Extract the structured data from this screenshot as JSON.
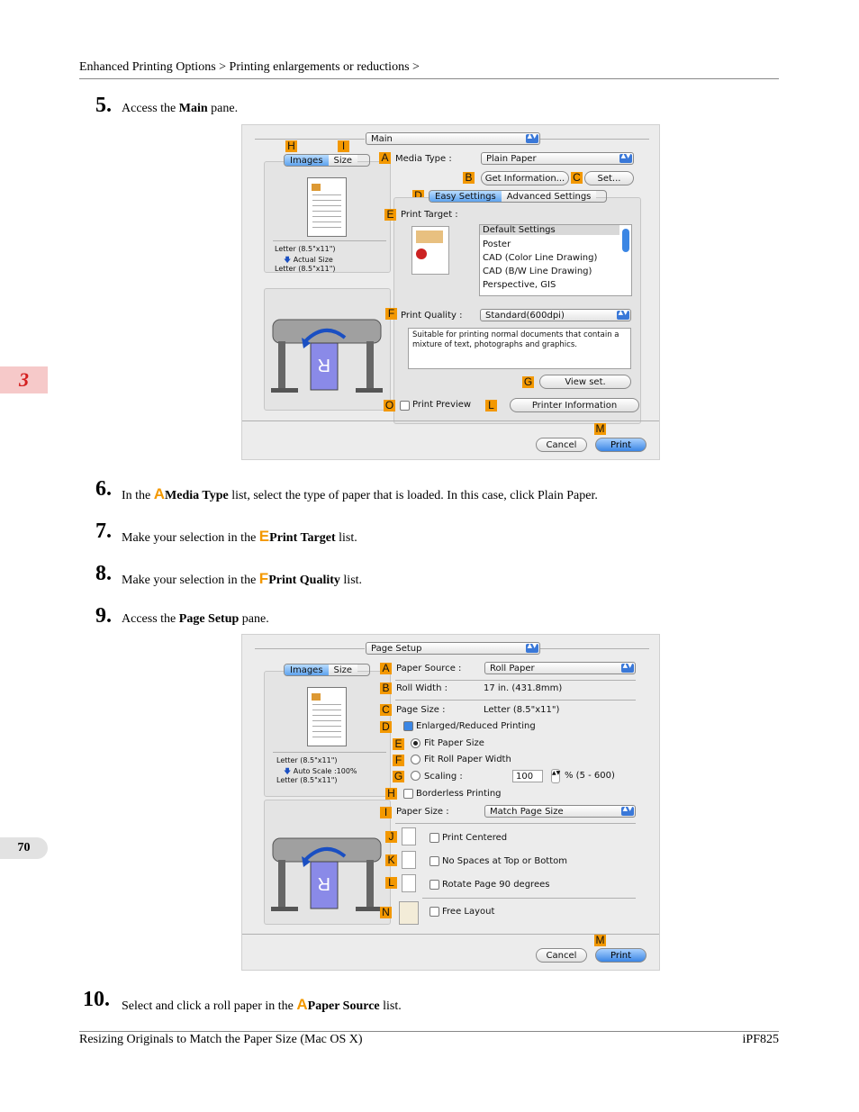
{
  "header": {
    "breadcrumb": "Enhanced Printing Options > Printing enlargements or reductions >"
  },
  "chapter": "3",
  "page_number": "70",
  "steps": [
    {
      "num": "5.",
      "pre": "Access the ",
      "bold": "Main",
      "post": " pane."
    },
    {
      "num": "6.",
      "pre": "In the ",
      "letter": "A",
      "bold": "Media Type",
      "post": " list, select the type of paper that is loaded. In this case, click Plain Paper."
    },
    {
      "num": "7.",
      "pre": "Make your selection in the ",
      "letter": "E",
      "bold": "Print Target",
      "post": " list."
    },
    {
      "num": "8.",
      "pre": "Make your selection in the ",
      "letter": "F",
      "bold": "Print Quality",
      "post": " list."
    },
    {
      "num": "9.",
      "pre": "Access the ",
      "bold": "Page Setup",
      "post": " pane."
    },
    {
      "num": "10.",
      "pre": "Select and click a roll paper in the ",
      "letter": "A",
      "bold": "Paper Source",
      "post": " list."
    }
  ],
  "dialog1": {
    "pane_popup": "Main",
    "tab_images": "Images",
    "tab_size": "Size",
    "preview_text1": "Letter (8.5\"x11\")",
    "preview_text2": "Actual Size",
    "preview_text3": "Letter (8.5\"x11\")",
    "media_type_label": "Media Type :",
    "media_type_value": "Plain Paper",
    "get_info_button": "Get Information...",
    "set_button": "Set...",
    "easy_settings_tab": "Easy Settings",
    "advanced_settings_tab": "Advanced Settings",
    "print_target_label": "Print Target :",
    "print_target_items": [
      "Default Settings",
      "Poster",
      "CAD (Color Line Drawing)",
      "CAD (B/W Line Drawing)",
      "Perspective, GIS"
    ],
    "print_quality_label": "Print Quality :",
    "print_quality_value": "Standard(600dpi)",
    "description": "Suitable for printing normal documents that contain a mixture of text, photographs and graphics.",
    "view_set_button": "View set.",
    "print_preview_label": "Print Preview",
    "printer_info_button": "Printer Information",
    "cancel_button": "Cancel",
    "print_button": "Print",
    "labels": {
      "H": "H",
      "I": "I",
      "A": "A",
      "B": "B",
      "C": "C",
      "D": "D",
      "E": "E",
      "F": "F",
      "G": "G",
      "O": "O",
      "L": "L",
      "M": "M"
    }
  },
  "dialog2": {
    "pane_popup": "Page Setup",
    "tab_images": "Images",
    "tab_size": "Size",
    "preview_text1": "Letter (8.5\"x11\")",
    "preview_text2": "Auto Scale :100%",
    "preview_text3": "Letter (8.5\"x11\")",
    "paper_source_label": "Paper Source :",
    "paper_source_value": "Roll Paper",
    "roll_width_label": "Roll Width :",
    "roll_width_value": "17 in. (431.8mm)",
    "page_size_label": "Page Size :",
    "page_size_value": "Letter (8.5\"x11\")",
    "enlarged_label": "Enlarged/Reduced Printing",
    "fit_paper_label": "Fit Paper Size",
    "fit_roll_label": "Fit Roll Paper Width",
    "scaling_label": "Scaling :",
    "scaling_value": "100",
    "scaling_range": "% (5 - 600)",
    "borderless_label": "Borderless Printing",
    "paper_size_label": "Paper Size :",
    "paper_size_value": "Match Page Size",
    "print_centered_label": "Print Centered",
    "no_spaces_label": "No Spaces at Top or Bottom",
    "rotate_label": "Rotate Page 90 degrees",
    "free_layout_label": "Free Layout",
    "cancel_button": "Cancel",
    "print_button": "Print",
    "labels": {
      "A": "A",
      "B": "B",
      "C": "C",
      "D": "D",
      "E": "E",
      "F": "F",
      "G": "G",
      "H": "H",
      "I": "I",
      "J": "J",
      "K": "K",
      "L": "L",
      "M": "M",
      "N": "N"
    }
  },
  "footer": {
    "left": "Resizing Originals to Match the Paper Size (Mac OS X)",
    "right": "iPF825"
  }
}
